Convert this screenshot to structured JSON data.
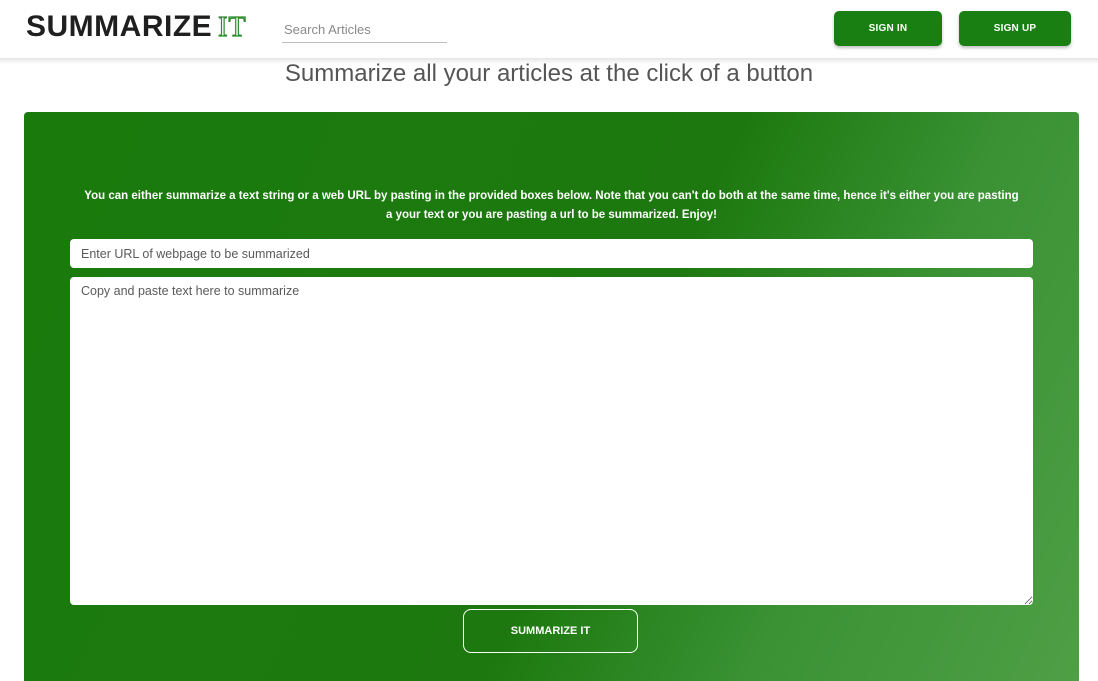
{
  "header": {
    "logo_main": "SUMMARIZE",
    "logo_accent": "IT",
    "search_placeholder": "Search Articles",
    "search_value": "",
    "sign_in_label": "SIGN IN",
    "sign_up_label": "SIGN UP"
  },
  "main": {
    "tagline": "Summarize all your articles at the click of a button",
    "instructions": "You can either summarize a text string or a web URL by pasting in the provided boxes below. Note that you can't do both at the same time, hence it's either you are pasting a your text or you are pasting a url to be summarized. Enjoy!",
    "url_placeholder": "Enter URL of webpage to be summarized",
    "url_value": "",
    "text_placeholder": "Copy and paste text here to summarize",
    "text_value": "",
    "summarize_label": "SUMMARIZE IT"
  },
  "colors": {
    "brand_green": "#1a7f12",
    "panel_green": "#1d790f",
    "logo_dark": "#1f1f1f"
  }
}
